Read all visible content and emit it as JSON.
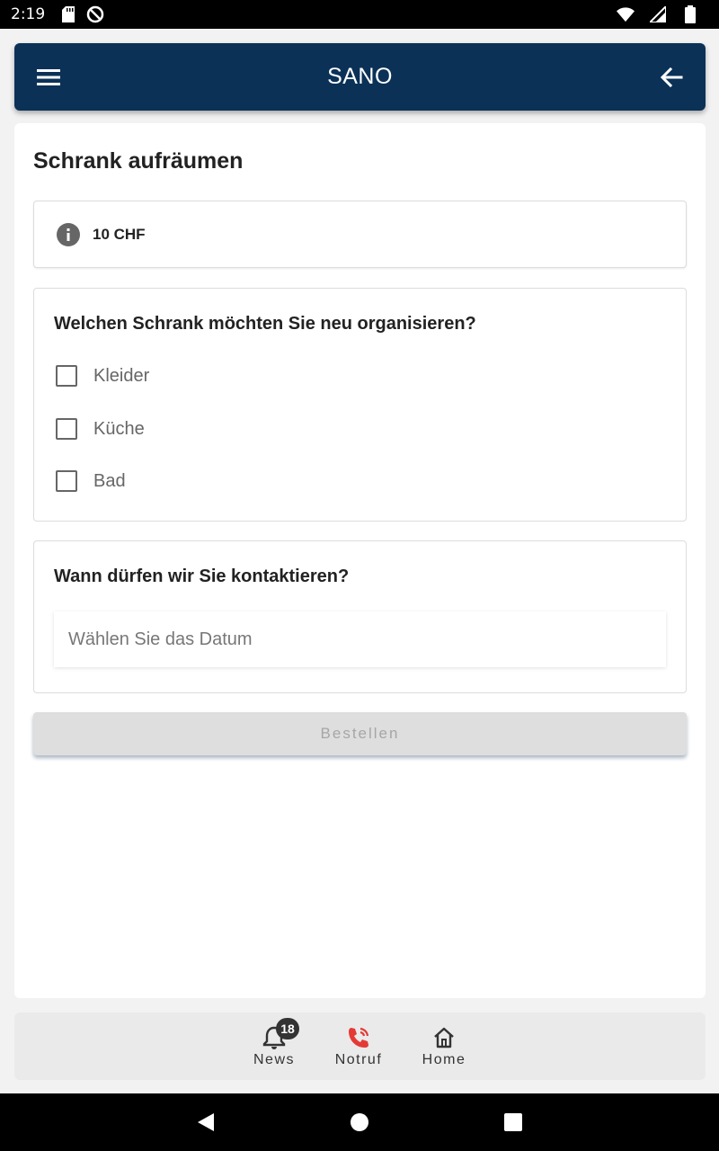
{
  "status_bar": {
    "time": "2:19"
  },
  "app_bar": {
    "title": "SANO",
    "menu_icon": "menu-icon",
    "back_icon": "arrow-left-icon"
  },
  "page": {
    "title": "Schrank aufräumen"
  },
  "price_card": {
    "icon": "info-icon",
    "price": "10 CHF"
  },
  "question_cabinet": {
    "title": "Welchen Schrank möchten Sie neu organisieren?",
    "options": [
      {
        "label": "Kleider",
        "checked": false
      },
      {
        "label": "Küche",
        "checked": false
      },
      {
        "label": "Bad",
        "checked": false
      }
    ]
  },
  "question_contact": {
    "title": "Wann dürfen wir Sie kontaktieren?",
    "date_placeholder": "Wählen Sie das Datum",
    "date_value": ""
  },
  "order_button": {
    "label": "Bestellen",
    "enabled": false
  },
  "bottom_nav": {
    "items": [
      {
        "label": "News",
        "icon": "bell-icon",
        "badge": "18"
      },
      {
        "label": "Notruf",
        "icon": "phone-call-icon",
        "color": "#e53935"
      },
      {
        "label": "Home",
        "icon": "home-icon"
      }
    ]
  },
  "colors": {
    "app_bar": "#0b3157",
    "emergency": "#e53935",
    "disabled_button": "#dedede"
  }
}
